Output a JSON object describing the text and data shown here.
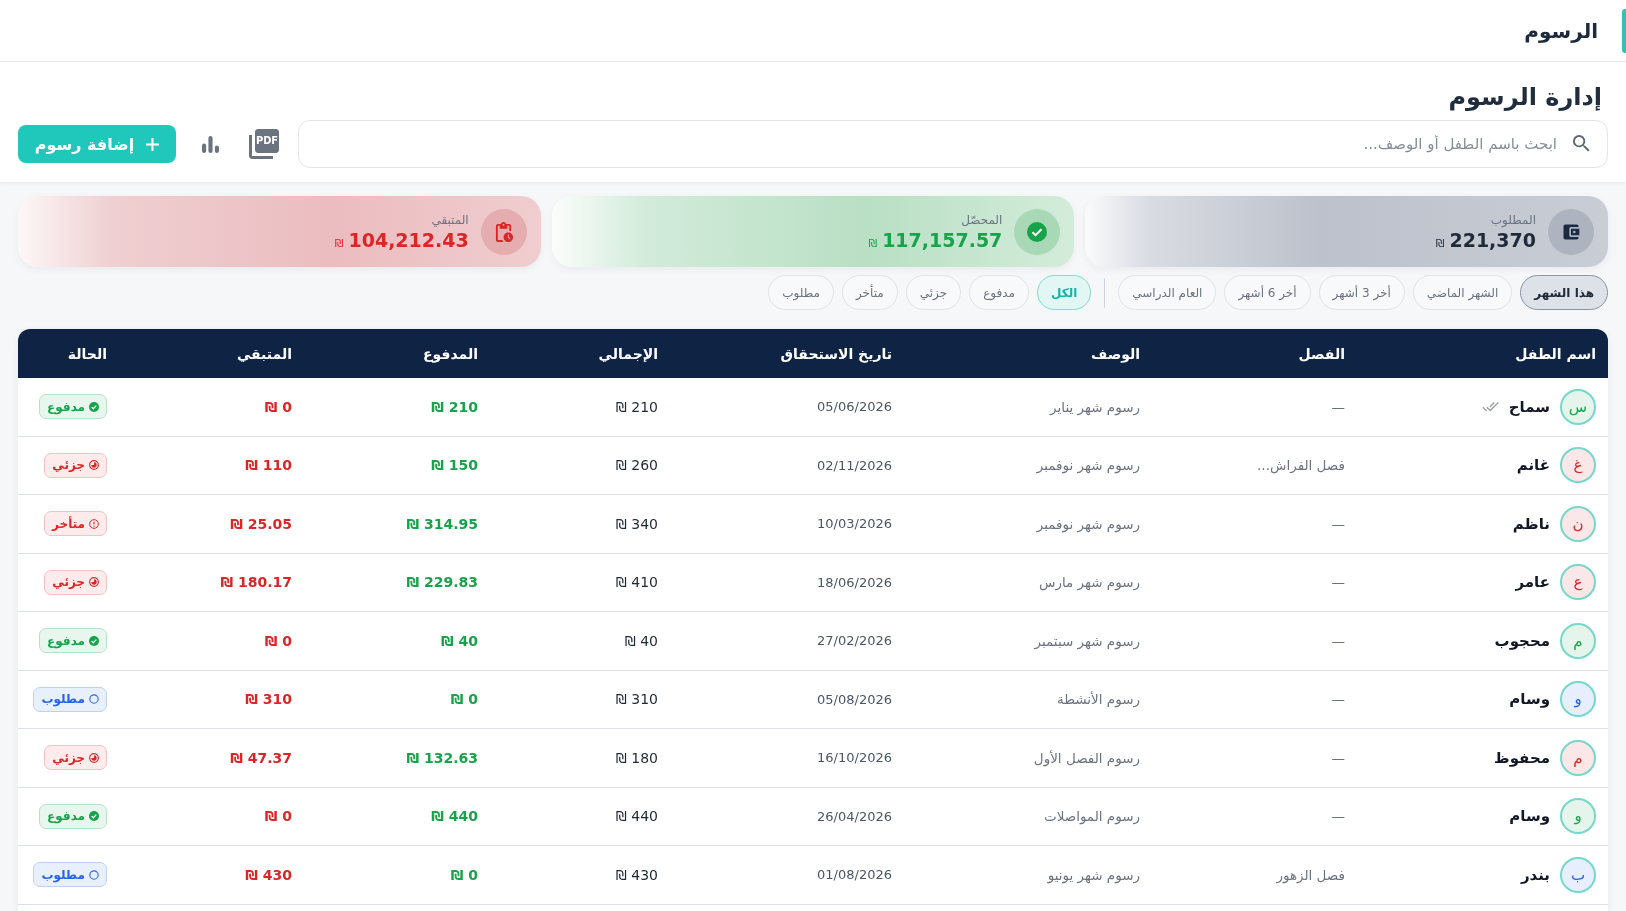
{
  "topbar": {
    "title": "الرسوم"
  },
  "header": {
    "title": "إدارة الرسوم",
    "search": {
      "placeholder": "ابحث باسم الطفل أو الوصف..."
    },
    "pdf_label": "PDF",
    "add_button": "إضافة رسوم"
  },
  "stats": [
    {
      "kind": "due",
      "label": "المطلوب",
      "value": "221,370",
      "currency": "₪"
    },
    {
      "kind": "collected",
      "label": "المحصّل",
      "value": "117,157.57",
      "currency": "₪"
    },
    {
      "kind": "remaining",
      "label": "المتبقي",
      "value": "104,212.43",
      "currency": "₪"
    }
  ],
  "period_filters": [
    {
      "label": "هذا الشهر",
      "selected": true
    },
    {
      "label": "الشهر الماضي",
      "selected": false
    },
    {
      "label": "أخر 3 أشهر",
      "selected": false
    },
    {
      "label": "أخر 6 أشهر",
      "selected": false
    },
    {
      "label": "العام الدراسي",
      "selected": false
    }
  ],
  "status_filters": [
    {
      "label": "الكل",
      "selected": true
    },
    {
      "label": "مدفوع",
      "selected": false
    },
    {
      "label": "جزئي",
      "selected": false
    },
    {
      "label": "متأخر",
      "selected": false
    },
    {
      "label": "مطلوب",
      "selected": false
    }
  ],
  "table": {
    "columns": [
      "اسم الطفل",
      "الفصل",
      "الوصف",
      "تاريخ الاستحقاق",
      "الإجمالي",
      "المدفوع",
      "المتبقي",
      "الحالة"
    ],
    "rows": [
      {
        "initial": "س",
        "color": "#16a34a",
        "name": "سماح",
        "confirmed": true,
        "class": "—",
        "description": "رسوم شهر يناير",
        "due_date": "05/06/2026",
        "total": "210 ₪",
        "paid": "210 ₪",
        "remaining": "0 ₪",
        "status": {
          "kind": "paid",
          "label": "مدفوع"
        }
      },
      {
        "initial": "غ",
        "color": "#dc2626",
        "name": "غانم",
        "confirmed": false,
        "class": "فصل الفراش...",
        "description": "رسوم شهر نوفمبر",
        "due_date": "02/11/2026",
        "total": "260 ₪",
        "paid": "150 ₪",
        "remaining": "110 ₪",
        "status": {
          "kind": "partial",
          "label": "جزئي"
        }
      },
      {
        "initial": "ن",
        "color": "#dc2626",
        "name": "ناظم",
        "confirmed": false,
        "class": "—",
        "description": "رسوم شهر نوفمبر",
        "due_date": "10/03/2026",
        "total": "340 ₪",
        "paid": "314.95 ₪",
        "remaining": "25.05 ₪",
        "status": {
          "kind": "late",
          "label": "متأخر"
        }
      },
      {
        "initial": "ع",
        "color": "#dc2626",
        "name": "عامر",
        "confirmed": false,
        "class": "—",
        "description": "رسوم شهر مارس",
        "due_date": "18/06/2026",
        "total": "410 ₪",
        "paid": "229.83 ₪",
        "remaining": "180.17 ₪",
        "status": {
          "kind": "partial",
          "label": "جزئي"
        }
      },
      {
        "initial": "م",
        "color": "#16a34a",
        "name": "محجوب",
        "confirmed": false,
        "class": "—",
        "description": "رسوم شهر سبتمبر",
        "due_date": "27/02/2026",
        "total": "40 ₪",
        "paid": "40 ₪",
        "remaining": "0 ₪",
        "status": {
          "kind": "paid",
          "label": "مدفوع"
        }
      },
      {
        "initial": "و",
        "color": "#2563eb",
        "name": "وسام",
        "confirmed": false,
        "class": "—",
        "description": "رسوم الأنشطة",
        "due_date": "05/08/2026",
        "total": "310 ₪",
        "paid": "0 ₪",
        "remaining": "310 ₪",
        "status": {
          "kind": "due",
          "label": "مطلوب"
        }
      },
      {
        "initial": "م",
        "color": "#dc2626",
        "name": "محفوظ",
        "confirmed": false,
        "class": "—",
        "description": "رسوم الفصل الأول",
        "due_date": "16/10/2026",
        "total": "180 ₪",
        "paid": "132.63 ₪",
        "remaining": "47.37 ₪",
        "status": {
          "kind": "partial",
          "label": "جزئي"
        }
      },
      {
        "initial": "و",
        "color": "#16a34a",
        "name": "وسام",
        "confirmed": false,
        "class": "—",
        "description": "رسوم المواصلات",
        "due_date": "26/04/2026",
        "total": "440 ₪",
        "paid": "440 ₪",
        "remaining": "0 ₪",
        "status": {
          "kind": "paid",
          "label": "مدفوع"
        }
      },
      {
        "initial": "ب",
        "color": "#2563eb",
        "name": "بندر",
        "confirmed": false,
        "class": "فصل الزهور",
        "description": "رسوم شهر يونيو",
        "due_date": "01/08/2026",
        "total": "430 ₪",
        "paid": "0 ₪",
        "remaining": "430 ₪",
        "status": {
          "kind": "due",
          "label": "مطلوب"
        }
      }
    ]
  }
}
